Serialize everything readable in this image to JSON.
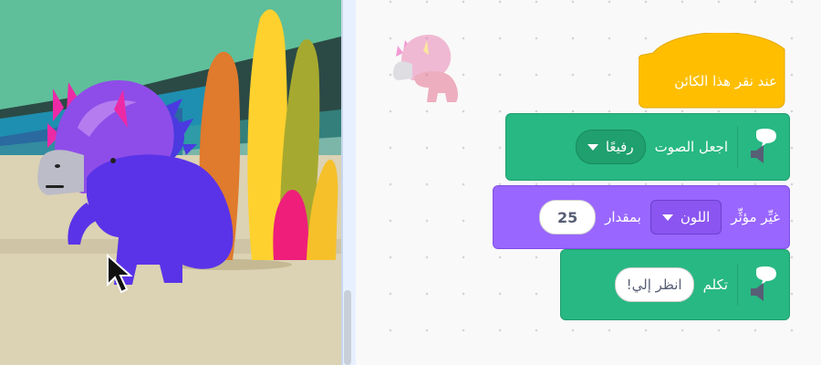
{
  "colors": {
    "events": "#ffbf00",
    "text_to_speech": "#28b883",
    "looks": "#9966ff",
    "stage_sky": "#5fbf9a",
    "stage_ground": "#dcd2b4"
  },
  "icons": {
    "stage_sprite": "dinosaur-sprite",
    "cursor": "mouse-cursor-icon",
    "thumb": "sprite-thumbnail",
    "ext": "speech-bubble-speaker-icon"
  },
  "scripts": {
    "hat": {
      "label": "عند نقر هذا الكائن"
    },
    "set_voice": {
      "label": "اجعل الصوت",
      "value": "رفيعًا"
    },
    "change_effect": {
      "label": "غيِّر مؤثِّر",
      "effect": "اللون",
      "by_label": "بمقدار",
      "amount": "25"
    },
    "speak": {
      "label": "تكلم",
      "text": "انظر إلي!"
    }
  }
}
